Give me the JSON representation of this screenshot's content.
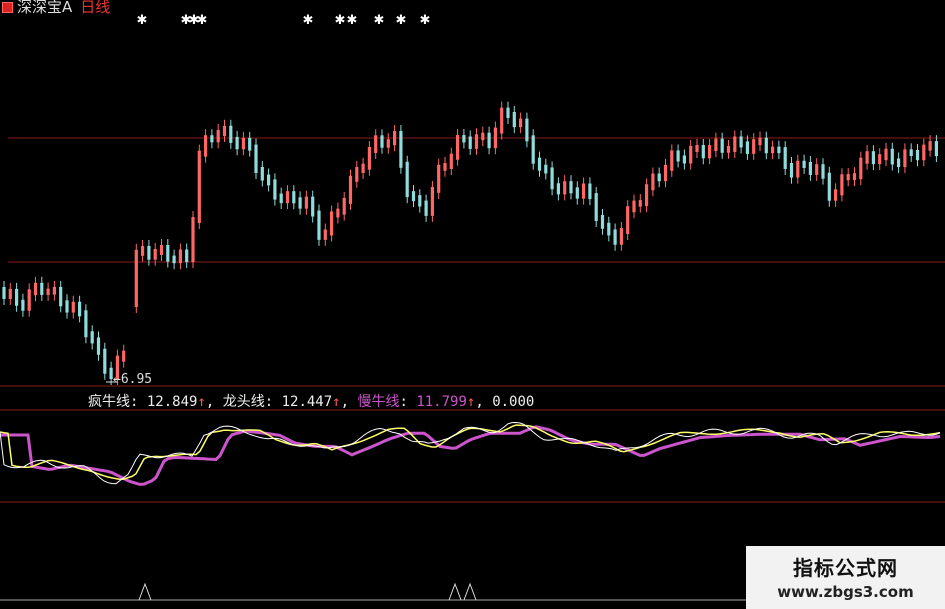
{
  "header": {
    "stock_name": "深深宝A",
    "period": "日线"
  },
  "main_panel": {
    "low_price_label": "6.95"
  },
  "indicator_legend": {
    "items": [
      {
        "name": "疯牛线",
        "value": "12.849",
        "arrow": "↑",
        "color": "#ffffff"
      },
      {
        "name": "龙头线",
        "value": "12.447",
        "arrow": "↑",
        "color": "#ffff66"
      },
      {
        "name": "慢牛线",
        "value": "11.799",
        "arrow": "↑",
        "color": "#cc55cc"
      }
    ],
    "extra_value": "0.000"
  },
  "watermark": {
    "title": "指标公式网",
    "url": "www.zbgs3.com"
  },
  "colors": {
    "up_candle": "#ff6666",
    "down_candle": "#8fdcdc",
    "grid_line": "#8b1a1a",
    "line_fast": "#ffffff",
    "line_leader": "#ffff66",
    "line_slow": "#cc55cc"
  }
}
